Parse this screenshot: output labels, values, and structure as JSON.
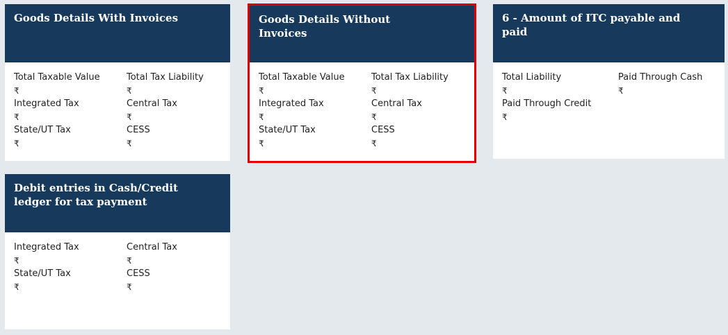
{
  "tiles": [
    {
      "title": "Goods Details With Invoices",
      "fields": [
        {
          "label": "Total Taxable Value",
          "value": "₹"
        },
        {
          "label": "Total Tax Liability",
          "value": "₹"
        },
        {
          "label": "Integrated Tax",
          "value": "₹"
        },
        {
          "label": "Central Tax",
          "value": "₹"
        },
        {
          "label": "State/UT Tax",
          "value": "₹"
        },
        {
          "label": "CESS",
          "value": "₹"
        }
      ]
    },
    {
      "title": "Goods Details Without Invoices",
      "fields": [
        {
          "label": "Total Taxable Value",
          "value": "₹"
        },
        {
          "label": "Total Tax Liability",
          "value": "₹"
        },
        {
          "label": "Integrated Tax",
          "value": "₹"
        },
        {
          "label": "Central Tax",
          "value": "₹"
        },
        {
          "label": "State/UT Tax",
          "value": "₹"
        },
        {
          "label": "CESS",
          "value": "₹"
        }
      ]
    },
    {
      "title": "6 - Amount of ITC payable and paid",
      "fields": [
        {
          "label": "Total Liability",
          "value": "₹"
        },
        {
          "label": "Paid Through Cash",
          "value": "₹"
        },
        {
          "label": "Paid Through Credit",
          "value": "₹"
        }
      ]
    },
    {
      "title": "Debit entries in Cash/Credit ledger for tax payment",
      "fields": [
        {
          "label": "Integrated Tax",
          "value": "₹"
        },
        {
          "label": "Central Tax",
          "value": "₹"
        },
        {
          "label": "State/UT Tax",
          "value": "₹"
        },
        {
          "label": "CESS",
          "value": "₹"
        }
      ]
    }
  ],
  "colors": {
    "header_bg": "#173a5c",
    "page_bg": "#e4e9ed",
    "selected_outline": "#e00000"
  }
}
